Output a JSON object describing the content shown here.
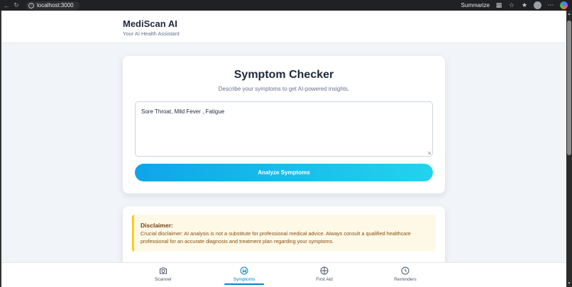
{
  "browser": {
    "url": "localhost:3000",
    "summarize_label": "Summarize"
  },
  "header": {
    "title": "MediScan AI",
    "subtitle": "Your AI Health Assistant"
  },
  "checker": {
    "title": "Symptom Checker",
    "subtitle": "Describe your symptoms to get AI-powered insights.",
    "input_value": "Sore Throat, Mild Fever , Fatigue",
    "analyze_label": "Analyze Symptoms"
  },
  "disclaimer": {
    "title": "Disclaimer:",
    "text": "Crucial disclaimer: AI analysis is not a substitute for professional medical advice. Always consult a qualified healthcare professional for an accurate diagnosis and treatment plan regarding your symptoms."
  },
  "nav": {
    "items": [
      {
        "label": "Scanner",
        "icon": "camera-icon"
      },
      {
        "label": "Symptoms",
        "icon": "symptoms-icon",
        "active": true
      },
      {
        "label": "First Aid",
        "icon": "first-aid-icon"
      },
      {
        "label": "Reminders",
        "icon": "clock-icon"
      }
    ]
  },
  "colors": {
    "accent": "#0284c7",
    "button_gradient_start": "#0ea5e9",
    "button_gradient_end": "#22d3ee",
    "disclaimer_border": "#facc15",
    "disclaimer_bg": "#fef9e7"
  }
}
